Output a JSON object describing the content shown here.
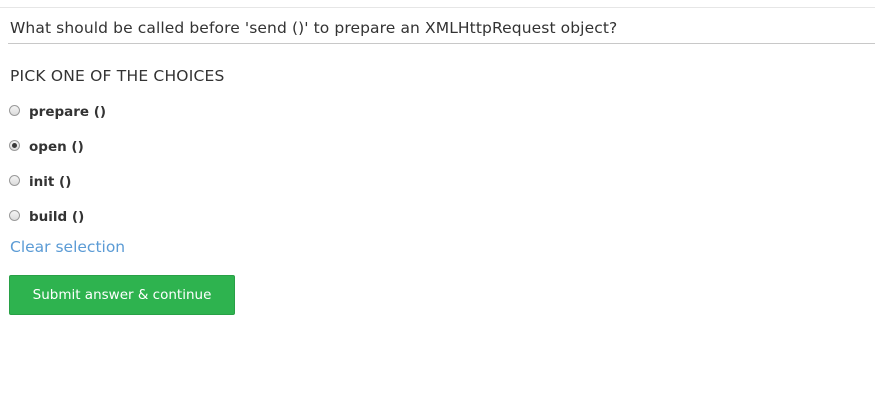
{
  "question": {
    "text": "What should be called before 'send ()' to prepare an XMLHttpRequest object?"
  },
  "choices_section": {
    "heading": "PICK ONE OF THE CHOICES",
    "options": [
      {
        "label": "prepare ()",
        "selected": false
      },
      {
        "label": "open ()",
        "selected": true
      },
      {
        "label": "init ()",
        "selected": false
      },
      {
        "label": "build ()",
        "selected": false
      }
    ]
  },
  "actions": {
    "clear_label": "Clear selection",
    "submit_label": "Submit answer & continue"
  },
  "colors": {
    "link": "#5b9bd5",
    "submit_button": "#2eb34f",
    "text": "#333333"
  }
}
